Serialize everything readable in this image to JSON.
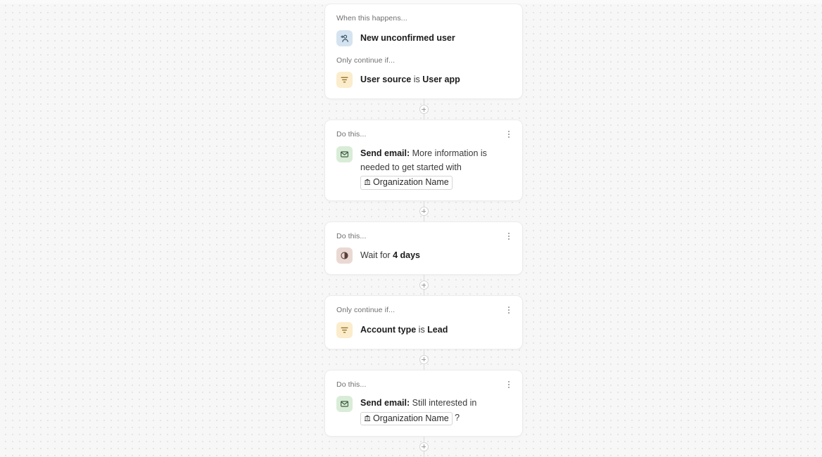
{
  "canvas": {
    "background_color": "#f7f7f7",
    "dot_color": "#e2e2e2"
  },
  "flow": {
    "cards": [
      {
        "id": "trigger-card",
        "has_menu": false,
        "sections": [
          {
            "label": "When this happens...",
            "icon": "person-add-icon",
            "icon_style": "icon-trigger",
            "segments": [
              {
                "type": "strong",
                "text": "New unconfirmed user"
              }
            ]
          },
          {
            "label": "Only continue if...",
            "icon": "filter-icon",
            "icon_style": "icon-filter",
            "segments": [
              {
                "type": "strong",
                "text": "User source"
              },
              {
                "type": "plain",
                "text": " is "
              },
              {
                "type": "strong",
                "text": "User app"
              }
            ]
          }
        ]
      },
      {
        "id": "send-email-card-1",
        "has_menu": true,
        "sections": [
          {
            "label": "Do this...",
            "icon": "envelope-icon",
            "icon_style": "icon-email",
            "segments": [
              {
                "type": "strong",
                "text": "Send email:"
              },
              {
                "type": "plain",
                "text": " More information is needed to get started with "
              },
              {
                "type": "token",
                "text": "Organization Name",
                "token_icon": "building-icon"
              }
            ]
          }
        ]
      },
      {
        "id": "wait-card",
        "has_menu": true,
        "sections": [
          {
            "label": "Do this...",
            "icon": "clock-icon",
            "icon_style": "icon-wait",
            "segments": [
              {
                "type": "plain",
                "text": "Wait for "
              },
              {
                "type": "strong",
                "text": "4 days"
              }
            ]
          }
        ]
      },
      {
        "id": "filter-card",
        "has_menu": true,
        "sections": [
          {
            "label": "Only continue if...",
            "icon": "filter-icon",
            "icon_style": "icon-filter",
            "segments": [
              {
                "type": "strong",
                "text": "Account type"
              },
              {
                "type": "plain",
                "text": " is "
              },
              {
                "type": "strong",
                "text": "Lead"
              }
            ]
          }
        ]
      },
      {
        "id": "send-email-card-2",
        "has_menu": true,
        "sections": [
          {
            "label": "Do this...",
            "icon": "envelope-icon",
            "icon_style": "icon-email",
            "segments": [
              {
                "type": "strong",
                "text": "Send email:"
              },
              {
                "type": "plain",
                "text": " Still interested in "
              },
              {
                "type": "token",
                "text": "Organization Name",
                "token_icon": "building-icon"
              },
              {
                "type": "plain",
                "text": " ?"
              }
            ]
          }
        ]
      }
    ],
    "connector": {
      "add_label": "+",
      "count": 5
    }
  }
}
